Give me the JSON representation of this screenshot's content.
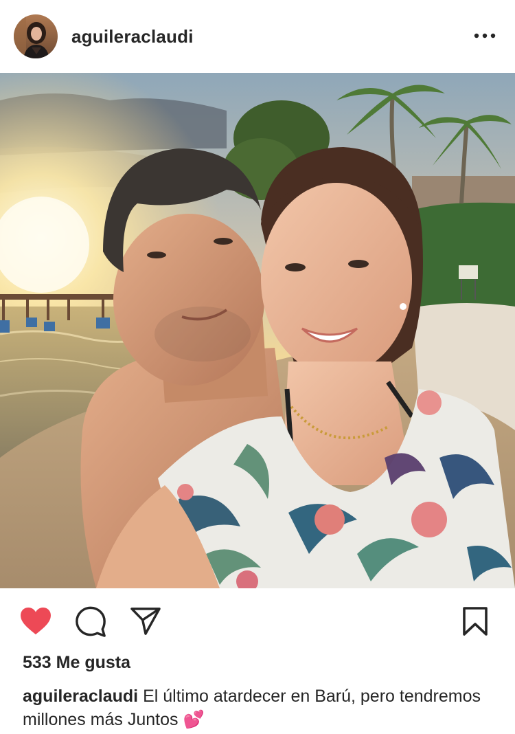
{
  "post": {
    "username": "aguileraclaudi",
    "more_icon": "more-horizontal-icon",
    "photo_description_icon": "photo",
    "likes_text": "533 Me gusta",
    "caption": {
      "username": "aguileraclaudi",
      "text": "El último atardecer en Barú, pero tendremos millones más Juntos",
      "emoji": "💕"
    },
    "liked": true,
    "colors": {
      "like_red": "#ED4956",
      "text": "#262626"
    }
  },
  "actions": {
    "like_icon": "heart-filled-icon",
    "comment_icon": "comment-icon",
    "share_icon": "send-icon",
    "save_icon": "bookmark-icon"
  }
}
